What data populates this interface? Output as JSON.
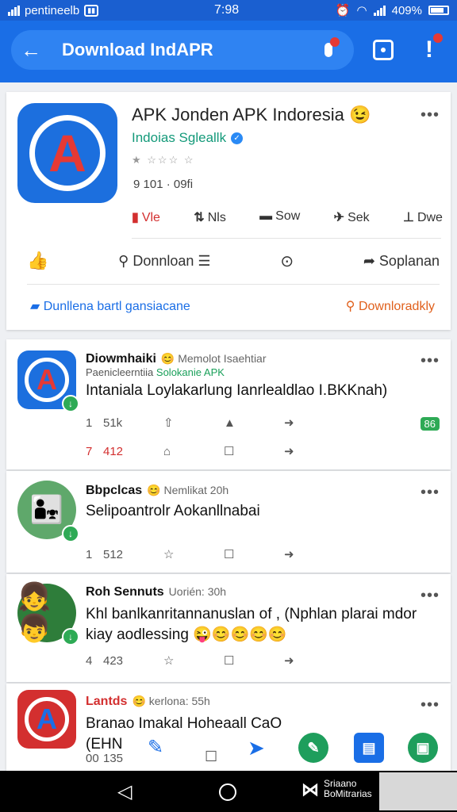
{
  "status_bar": {
    "carrier": "pentineelb",
    "time": "7:98",
    "battery": "409%"
  },
  "header": {
    "search_text": "Download IndAPR"
  },
  "app": {
    "title": "APK Jonden APK Indoresia",
    "title_emoji": "😉",
    "publisher": "Indoias Sgleallk",
    "rating_stars": "★ ☆☆☆ ☆",
    "downloads": "9  101 · 09fi",
    "stats": [
      {
        "icon": "▮",
        "label": "Vle"
      },
      {
        "icon": "⇅",
        "label": "Nls"
      },
      {
        "icon": "▬",
        "label": "Sow"
      },
      {
        "icon": "✈",
        "label": "Sek"
      },
      {
        "icon": "⊥",
        "label": "Dwe"
      }
    ],
    "actions": {
      "download_label": "Donnloan",
      "share_label": "Soplanan"
    },
    "links": {
      "left": "Dunllena bartl gansiacane",
      "right": "Downloradkly"
    }
  },
  "posts": [
    {
      "name": "Diowmhaiki",
      "meta": "😊 Memolot Isaehtiar",
      "sub": "Paenicleerntiia",
      "tag": "Solokanie APK",
      "text": "Intaniala Loylakarlung Ianrlealdlao I.BKKnah)",
      "row1": [
        "1",
        "51k"
      ],
      "row2": [
        "7",
        "412"
      ],
      "pill": "86"
    },
    {
      "name": "Bbpclcas",
      "meta": "😊 Nemlikat 20h",
      "text": "Selipoantrolr Aokanllnabai",
      "row1": [
        "1",
        "512"
      ]
    },
    {
      "name": "Roh Sennuts",
      "meta": "Uorién: 30h",
      "text": "Khl banlkanritannanuslan of , (Nphlan plarai mdor kiay aodlessing 😜😊😊😊😊",
      "row1": [
        "4",
        "423"
      ]
    },
    {
      "name": "Lantds",
      "meta": "😊 kerlona: 55h",
      "text": "Branao Imakal Hoheaall CaO (EHN",
      "row1": [
        "00",
        "135"
      ]
    }
  ],
  "nav": {
    "brand_line1": "Sriaano",
    "brand_line2": "BoMitrarias"
  }
}
